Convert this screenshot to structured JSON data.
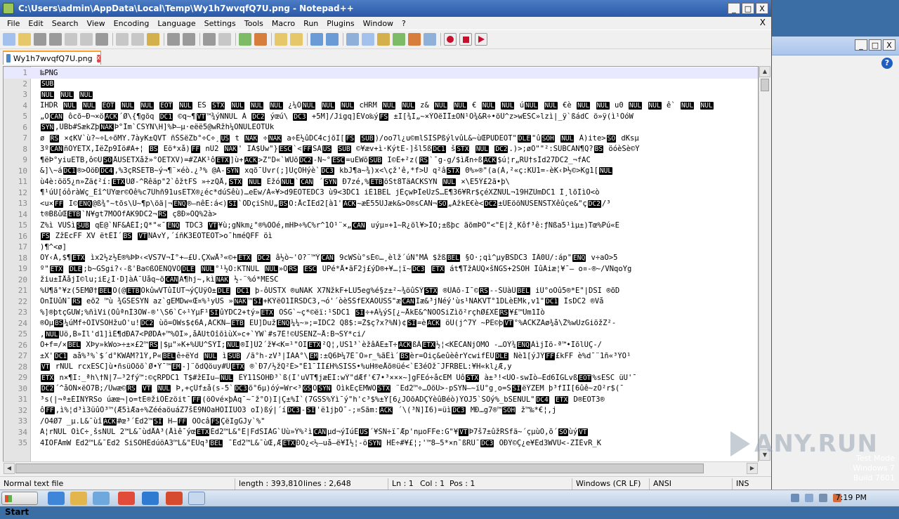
{
  "window": {
    "title": "C:\\Users\\admin\\AppData\\Local\\Temp\\Wy1h7wvqfQ7U.png - Notepad++",
    "min": "_",
    "max": "□",
    "close": "X"
  },
  "menu": [
    "File",
    "Edit",
    "Search",
    "View",
    "Encoding",
    "Language",
    "Settings",
    "Tools",
    "Macro",
    "Run",
    "Plugins",
    "Window",
    "?"
  ],
  "menu_close": "X",
  "tab": {
    "label": "Wy1h7wvqfQ7U.png",
    "close": "x"
  },
  "editor_lines": [
    {
      "n": "1",
      "t": "‰PNG"
    },
    {
      "n": "2",
      "t": "SUB"
    },
    {
      "n": "3",
      "t": "NUL NUL NUL"
    },
    {
      "n": "4",
      "t": "IHDR NUL NUL EOT NUL NUL EOT NUL ES STX NUL NUL NUL ¿¼ÔNUL NUL NUL  cHRM NUL NUL z& NUL NUL € NUL NUL úNUL NUL €è NUL NUL u0 NUL NUL ê` NUL NUL"
    },
    {
      "n": "5",
      "t": "„ÕCAN ôcõ~Ð¬×öACK´Ø\\{¶gõq DC1 ©q~¶VT™¾ýNNUL À DC2 ýœú\\ DC3 +5M]/Jigq]ÈVo‰ýFS ±I[¾I„~×ÝÖëÎÎ±OÑ¹Ö¾&R÷•öÜ^z>wESC»lzì|_ÿ`ßádC ö»ÿ(ì¹ÓóW"
    },
    {
      "n": "6",
      "t": "SYN,ÜBb#SækZþNAKÞ°Îm`CSYN\\H]%Þ—µ·eëë5@wRžh¼ÕNULEOTÜk"
    },
    {
      "n": "7",
      "t": "  ø RS ×¢KV`ù?~÷L÷õMY.7àyK±QVT ñŠSëZb°÷C÷¸US t NAK ÷NAK a÷É½ûDC4cjõI[FS  SUB)/oo7l¿u©mlSIŠPßýlvûL&~ùŒPUDEOT\"DLE\"ûSOH NUL À)ite>SO dKsµ"
    },
    {
      "n": "8",
      "t": "3ºCANñÖYETX,ÎëŽp9Ìö#Ä+¦ BS  Ëö*xå)FF nÜ2 NAK' IÀ$Üw\"}ESC`<FFŠÄUS SUB ©¥æv+ì·KýtË-]šl5ßDC1 šSTX NUL DC2.)>;øÔ\"\"²:SUBCAN¶Q?BS öóèŠè©Ÿ"
    },
    {
      "n": "9",
      "t": "¶ëÞ°yiuETB,ô©ÜSOÅUSETXåž»°ÕETXV)=#ZÃK¹ôETX]ù+ACK>Z\"D«`WÜõDC2-Ñ~°ESC=uÈWõSUB I©Ê+²z(RS`¯g-g/$ìÆn÷ßACK$ú¦r„RÜ†sÌd27DC2_¬fAC"
    },
    {
      "n": "10",
      "t": "&]\\~áDC1®>ÕöÐDC4,%3çRSETB~ý¬¶¨×éò.¿³% @A-SYN xqõ¯Üvr(;]ÙçÕHýè`DC3 kbJ¶a~¾)x<\\çž'ê,*f>Ù q²âSTX 0%»®\"(a(À,²«ç:KÜ1=-èK‹Þ½©>Kg1[NUL"
    },
    {
      "n": "11",
      "t": "ù4è:öö5¿n»Žä¢²í:ETXÜØ-^Rêäp\"2`ôžtFS »÷zQÅ,STX NUL ÈžóNUL`CAN ´SYN Ð7zé,%ETBõŠt8TäACKSYN NUL ×\\E5Ý£2ã•þ\\"
    },
    {
      "n": "12",
      "t": "¶¹úÜ[óôràWç_Èî^ÜYœr©Ôê%c7Ühñ91usETX®¿éc*dúSêù)…eËw/Á«¥>d9EOTEDC3 ù9<3DC1 iÈ1BEL jÈçwÞÎeÛzŠ…E¶36¥Rr$çéXZNUL¬19HZÜmDC1 Ì¸lõÏìÕ<ò"
    },
    {
      "n": "13",
      "t": "<u×FF I©ENQ@ß¾°~tõs\\Ú~¶p\\öä|¬ENQ®—nêË:á<)SI`ÖDçiŠhÜ„BSÕ:ÅcÎËd2[à1'ACK~æÈ55ÜJæk&>O®sCAN¬SO„ÃžkE€è<DC2±ÚEööNÚSENSTXêûçe&\"çDC2/³"
    },
    {
      "n": "14",
      "t": " t®BßûŒETB`N¥gt7MÓÖfÃK9DC2¬RS ç8Ð»ÒQ%2à>"
    },
    {
      "n": "15",
      "t": "Z%ì VÜŠìSUB qE@`ÑF&ÁÉÌ;Q*\"«¯ENQ TDC3 VT¥ù;gÑkm¿°®%ÕÖé,mHÞ÷%C%r^1Ó¹¨×„CAN uýµ¤+1~R¿öl¥>ÌÒ;±ßþc ãõmÞÖ\"<\"É|ž¸Kôf³ê:ƒNßa5¹ìµ±)Tœ%Pú«Ë"
    },
    {
      "n": "16",
      "t": "FS ZžËcFF XV ëtÈÌ´BS VTÑÃvŸ,´íñK3EOTEOT>o¯hméQFF öì"
    },
    {
      "n": "17",
      "t": ")¶^<ø]"
    },
    {
      "n": "18",
      "t": "ÕY‹À,$¶ETX ìx2½z½È®%ÞÞ‹<VS7V¬Ì°+—£Ú.ÇXwÅ³«©+ETX DC2 â½ò~'O?¨™ÝCAN 9cWŠù°sÉ©…¸èlž´úÑ°MÂ $žßBEL §O·;qì^µyBSDC3 ÍÂ0Ú/:áp\"ENQ v÷aÓ>5"
    },
    {
      "n": "19",
      "t": "º\"ETX DLE;b~GSgi?‹-ß'Ba©ßÕENQVÔDLE NUL°¹½Õ:KTNUL NUL»ÕRS ESC ÙPé*Å•ãF2j£ýD®+¥…¦ï~DC3 ETX át¶TžÃÛQ×šNGS+2SOH ÎûÂiæ¦¥¯— o¤-®~/VÑqoYg"
    },
    {
      "n": "20",
      "t": "žiu±ÌÅåjI©lu;iE¿Í·D]àÀ¯Ùåq~õCANÄ¶hj~,kìNAK ½-¨%ó*MESC"
    },
    {
      "n": "21",
      "t": "%Ü¶ã°¥z(5EMØ†BELÖ(@ETBÕkûwVTûÌÙT¬ýÇÙÿÒ±DLE DC1 þ-ôUSTX ®uNAK X7ÑžkF+LU5eg%é§z±²~¾öûŠÝSTX ®ÛÄõ-I¯©RS--ŠÛàÜBEL iÚ°oOû5®*E\"|DSI ®õD"
    },
    {
      "n": "22",
      "t": "ÕnÍÙûÑ¯RS eõ2 ™ù ¾GSESYN az`gEMDw«Œ¤%¹yUS »NAK™SI+KÝëÓ1ÍRSDC3,¬ó'´òèŠŠfEXÃÕUSS\"æCANÍæ&³jÑéý'ùs¹NAKVT°1DLèEMk,v1\"DC1 ÎsDC2 ®Vå"
    },
    {
      "n": "23",
      "t": "%]®þtçGUW;%ñìVi(ÕûªnÌ3ÖW-®'\\S6`C÷¹YµF¹SIûYDC2+tý»ETX ÕŠG`~ç*©ëï:¹SDC1 SI÷+Ã¼ýS[¿~ÅkE&^NOOSiZìõ²rçhØ£XÊRS¥£™Üm1Íò"
    },
    {
      "n": "24",
      "t": "®ÕµBS¼úMf÷ÕÏVSOHžuÒ'u!DC2 ùõ=OWs$¢6À,ACKN—ETB EU]DužENQ¼¼~»;=IDC2 Q8$:=Ž$ç?x?%N)¢SI=èACK öÜ(j^7Ý ~PE©þVT°%ACKZÃø¾å\\Ž%wUzGiöžZ²-"
    },
    {
      "n": "25",
      "t": ",NULÜö,B»Ìl'd1]ìÉ¶dÐÃ7<PØDÀ+™%ÒÍ»,åÂÙtÕîõìùX»c+`YW`#s7È!©USENZ~Å:B¬SÝ*ci/"
    },
    {
      "n": "26",
      "t": "Ó+f=/×BEL XÞy»kWo>÷±×£2™RS|$µ\"»K+%ÚU^ŠÝÍ;NUL®Î]Ü2´ž¥<K=¹\"ÖÏETX²Q¦,US1³`èžâÂË±T÷ACKßÂETX½¦<KÊCANjÖMÒ -…OÝ¾ENQÀìjÌö-ª™•ÌõlÚÇ-/"
    },
    {
      "n": "27",
      "t": "±X'DC1 aå%³%`$´d°KWÀM?1Ý,P«BELê÷ëYd NUL ìSUB /ã°h-zV³|ÌÀÃ°\\EM:±Q6Þ¼7É¯Õ»r_%ãÊì´BSèr=Õiç&eûèêrYcwifÈÚDLE Ñè1[ýJÝFF£kFF è%d¯¨1ñ«³ÝÖ¹"
    },
    {
      "n": "28",
      "t": "VT rNUL rcxESC]ù•ñsüÕõõ`Ø•Ý¯™EM-]¨õdQöuy#ÚETX ®`Ð7/½žQ²É>\"Ê1¯ÌÍ£H%SISS•%uH®eÅõ®üé<`Ë3éÕž¯JFRBEL:¥H«kl¿Æ,y"
    },
    {
      "n": "29",
      "t": "ETX n×¶I:_ªh\\†Ñ|7–³2fý™:©çRPDC1 T$#žEIu—NUL ÊÝ11SOHÐ³`ß(Ï'uVT¶jæÊI:wÝ\"dÆf'€7•³×××~]gFEó÷åcEM ÜôSTX à±³!<ÜÖ-swÌò—Éd6ÎGLvßEOT%sESC üU'¯"
    },
    {
      "n": "30",
      "t": "DC2´^åÕÑ×ëÔ7B;/Üwæ©RS VT NUL Þ,+çÛf±å(s-5`DC3õ°6µ)óý=Wr<³GSÕSYN ÕìkÉçEMWÕSTX ¨Ëd2™÷…ÒõÙ>-pSYN—~ïÙ°g¸o=ŠSIëÝZEM þ³fIÍ[6ûê~zÕ²r$(¯"
    },
    {
      "n": "31",
      "t": "³s(|¬ª±ÈÏÑÝRSo   úæœ¬|o=tE®žiÕÉzöit¯FF(öÖvé×þÀq¯~¯ž°O)I|Ç±%Ì`(7GSS%Ýì¯ý\"h'c³$%±Ý[6¿JÕõÄDÇÝèûBéò)ÝOJ5`SÔý%_bSENUL\"DC4 ETX D®EOT3®"
    },
    {
      "n": "32",
      "t": "ôFF,ì%¦d³ì3üûÓ³™(Æ5ìÆa÷%ZééaöuáZ7šÉ9NÕaHÕÏÏÚÕ3     oÏ)ßý|´íDC3-SI'ë1jþÓ¯-;¤Sãm:ACK ´\\(³N]Ï6)=üìDC3 MÐ…g7®™SOH ž™‰*€¦,j"
    },
    {
      "n": "33",
      "t": "/Õ4Ø7 _µ.L&¯ùîACK#œ³´Éd2™SI H—FF ÕÕcâFSÇëIgGJy`%\""
    },
    {
      "n": "34",
      "t": "Ä¦rNUL ÕìC÷¸šsNUL 2™L&¯ùdÅÀ³(Åìê¯ýœETXÉd2™L&°Ê|FdSIÀG`Üù»Ý%²ìCANµd¬ýÍúÊUS´¥ŠN÷ï¯Æp'nµoFFe:G\"¥VTÞ7š7±ûžRSfä~´çµùÓ,õ´SOùýVT"
    },
    {
      "n": "35",
      "t": "4ÎOFÀmW Éd2™L&¯Éd2 ŠiSOHÉdúöA3™L&\"ÉÙq³BEL  ¯Éd2™L&¯ùŒ,ÆETXÐO¿<½—uå—ë¥Ì½¦-öSYN HÉ÷#¥£¦;'™8—5*×n¯ßRÜ¯DC3 ÔÐÝ©Ç¿e¥Éd3WVÜ<-ZÎÉvR_K"
    }
  ],
  "status": {
    "type": "Normal text file",
    "length": "length : 393,810",
    "lines": "lines : 2,648",
    "ln": "Ln : 1",
    "col": "Col : 1",
    "pos": "Pos : 1",
    "eol": "Windows (CR LF)",
    "encoding": "ANSI",
    "mode": "INS"
  },
  "watermark": "ANY.RUN",
  "winmark": {
    "line1": "Test Mode",
    "line2": "Windows 7",
    "line3": "Build 7601"
  },
  "taskbar": {
    "start": "Start",
    "clock": "7:19 PM"
  },
  "icons": [
    "new-file-icon",
    "open-icon",
    "save-icon",
    "save-all-icon",
    "close-icon",
    "close-all-icon",
    "print-icon",
    "cut-icon",
    "copy-icon",
    "paste-icon",
    "undo-icon",
    "redo-icon",
    "find-icon",
    "replace-icon",
    "zoom-in-icon",
    "zoom-out-icon",
    "sync-v-icon",
    "sync-h-icon",
    "word-wrap-icon",
    "all-chars-icon",
    "indent-guide-icon",
    "udl-icon",
    "doc-map-icon",
    "function-list-icon",
    "folder-workspace-icon",
    "monitor-icon",
    "record-macro-icon",
    "stop-macro-icon",
    "play-macro-icon"
  ]
}
